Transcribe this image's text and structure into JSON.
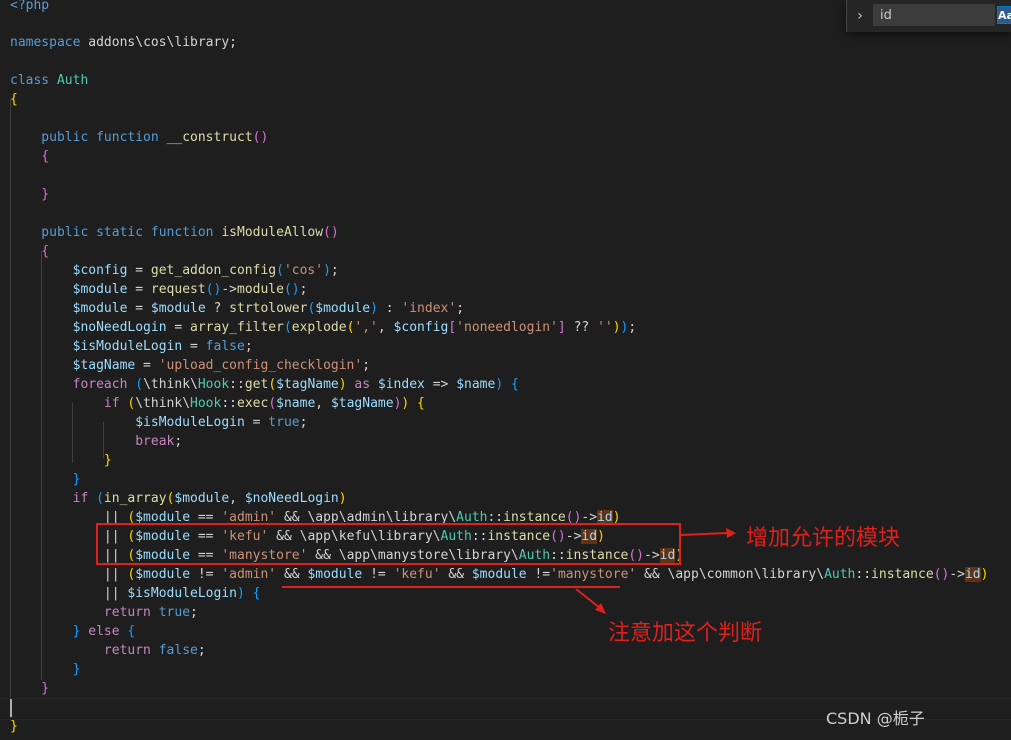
{
  "find_widget": {
    "query": "id",
    "match_case_label": "Aa"
  },
  "annotations": {
    "allowed_modules": "增加允许的模块",
    "note_condition": "注意加这个判断"
  },
  "watermark": "CSDN @栀子",
  "colors": {
    "annotation_red": "#e0201c",
    "editor_background": "#1e1e1e",
    "keyword": "#569cd6",
    "string": "#ce9178",
    "variable": "#9cdcfe",
    "function": "#dcdcaa",
    "class": "#4ec9b0",
    "match_highlight": "#613214"
  },
  "code": {
    "l0": [
      {
        "t": "<?php",
        "c": "kw"
      }
    ],
    "l1": [
      {
        "t": "namespace ",
        "c": "kw"
      },
      {
        "t": "addons\\cos\\library",
        "c": "plain"
      },
      {
        "t": ";",
        "c": "plain"
      }
    ],
    "l2": [
      {
        "t": "class ",
        "c": "kw"
      },
      {
        "t": "Auth",
        "c": "cls"
      }
    ],
    "l3": [
      {
        "t": "{",
        "c": "br1"
      }
    ],
    "l4": [
      {
        "t": "    public ",
        "c": "kw"
      },
      {
        "t": "function ",
        "c": "kw"
      },
      {
        "t": "__construct",
        "c": "fn"
      },
      {
        "t": "()",
        "c": "br2"
      }
    ],
    "l5": [
      {
        "t": "    {",
        "c": "br2"
      }
    ],
    "l6": [
      {
        "t": "    }",
        "c": "br2"
      }
    ],
    "l7": [
      {
        "t": "    public ",
        "c": "kw"
      },
      {
        "t": "static ",
        "c": "kw"
      },
      {
        "t": "function ",
        "c": "kw"
      },
      {
        "t": "isModuleAllow",
        "c": "fn"
      },
      {
        "t": "()",
        "c": "br2"
      }
    ],
    "l8": [
      {
        "t": "    {",
        "c": "br2"
      }
    ],
    "l9": [
      {
        "t": "        $config",
        "c": "var"
      },
      {
        "t": " = ",
        "c": "plain"
      },
      {
        "t": "get_addon_config",
        "c": "fn"
      },
      {
        "t": "(",
        "c": "br3"
      },
      {
        "t": "'cos'",
        "c": "str"
      },
      {
        "t": ")",
        "c": "br3"
      },
      {
        "t": ";",
        "c": "plain"
      }
    ],
    "l10": [
      {
        "t": "        $module",
        "c": "var"
      },
      {
        "t": " = ",
        "c": "plain"
      },
      {
        "t": "request",
        "c": "fn"
      },
      {
        "t": "()",
        "c": "br3"
      },
      {
        "t": "->",
        "c": "plain"
      },
      {
        "t": "module",
        "c": "fn"
      },
      {
        "t": "()",
        "c": "br3"
      },
      {
        "t": ";",
        "c": "plain"
      }
    ],
    "l11": [
      {
        "t": "        $module",
        "c": "var"
      },
      {
        "t": " = ",
        "c": "plain"
      },
      {
        "t": "$module",
        "c": "var"
      },
      {
        "t": " ? ",
        "c": "plain"
      },
      {
        "t": "strtolower",
        "c": "fn"
      },
      {
        "t": "(",
        "c": "br3"
      },
      {
        "t": "$module",
        "c": "var"
      },
      {
        "t": ")",
        "c": "br3"
      },
      {
        "t": " : ",
        "c": "plain"
      },
      {
        "t": "'index'",
        "c": "str"
      },
      {
        "t": ";",
        "c": "plain"
      }
    ],
    "l12": [
      {
        "t": "        $noNeedLogin",
        "c": "var"
      },
      {
        "t": " = ",
        "c": "plain"
      },
      {
        "t": "array_filter",
        "c": "fn"
      },
      {
        "t": "(",
        "c": "br3"
      },
      {
        "t": "explode",
        "c": "fn"
      },
      {
        "t": "(",
        "c": "br1"
      },
      {
        "t": "','",
        "c": "str"
      },
      {
        "t": ", ",
        "c": "plain"
      },
      {
        "t": "$config",
        "c": "var"
      },
      {
        "t": "[",
        "c": "br2"
      },
      {
        "t": "'noneedlogin'",
        "c": "str"
      },
      {
        "t": "]",
        "c": "br2"
      },
      {
        "t": " ?? ",
        "c": "plain"
      },
      {
        "t": "''",
        "c": "str"
      },
      {
        "t": ")",
        "c": "br1"
      },
      {
        "t": ")",
        "c": "br3"
      },
      {
        "t": ";",
        "c": "plain"
      }
    ],
    "l13": [
      {
        "t": "        $isModuleLogin",
        "c": "var"
      },
      {
        "t": " = ",
        "c": "plain"
      },
      {
        "t": "false",
        "c": "kw"
      },
      {
        "t": ";",
        "c": "plain"
      }
    ],
    "l14": [
      {
        "t": "        $tagName",
        "c": "var"
      },
      {
        "t": " = ",
        "c": "plain"
      },
      {
        "t": "'upload_config_checklogin'",
        "c": "str"
      },
      {
        "t": ";",
        "c": "plain"
      }
    ],
    "l15": [
      {
        "t": "        foreach ",
        "c": "ctl"
      },
      {
        "t": "(",
        "c": "br3"
      },
      {
        "t": "\\think\\",
        "c": "plain"
      },
      {
        "t": "Hook",
        "c": "cls"
      },
      {
        "t": "::",
        "c": "plain"
      },
      {
        "t": "get",
        "c": "fn"
      },
      {
        "t": "(",
        "c": "br1"
      },
      {
        "t": "$tagName",
        "c": "var"
      },
      {
        "t": ")",
        "c": "br1"
      },
      {
        "t": " as ",
        "c": "ctl"
      },
      {
        "t": "$index",
        "c": "var"
      },
      {
        "t": " => ",
        "c": "plain"
      },
      {
        "t": "$name",
        "c": "var"
      },
      {
        "t": ")",
        "c": "br3"
      },
      {
        "t": " {",
        "c": "br3"
      }
    ],
    "l16": [
      {
        "t": "            if ",
        "c": "ctl"
      },
      {
        "t": "(",
        "c": "br1"
      },
      {
        "t": "\\think\\",
        "c": "plain"
      },
      {
        "t": "Hook",
        "c": "cls"
      },
      {
        "t": "::",
        "c": "plain"
      },
      {
        "t": "exec",
        "c": "fn"
      },
      {
        "t": "(",
        "c": "br2"
      },
      {
        "t": "$name",
        "c": "var"
      },
      {
        "t": ", ",
        "c": "plain"
      },
      {
        "t": "$tagName",
        "c": "var"
      },
      {
        "t": ")",
        "c": "br2"
      },
      {
        "t": ")",
        "c": "br1"
      },
      {
        "t": " {",
        "c": "br1"
      }
    ],
    "l17": [
      {
        "t": "                $isModuleLogin",
        "c": "var"
      },
      {
        "t": " = ",
        "c": "plain"
      },
      {
        "t": "true",
        "c": "kw"
      },
      {
        "t": ";",
        "c": "plain"
      }
    ],
    "l18": [
      {
        "t": "                break",
        "c": "ctl"
      },
      {
        "t": ";",
        "c": "plain"
      }
    ],
    "l19": [
      {
        "t": "            }",
        "c": "br1"
      }
    ],
    "l20": [
      {
        "t": "        }",
        "c": "br3"
      }
    ],
    "l21": [
      {
        "t": "        if ",
        "c": "ctl"
      },
      {
        "t": "(",
        "c": "br3"
      },
      {
        "t": "in_array",
        "c": "fn"
      },
      {
        "t": "(",
        "c": "br1"
      },
      {
        "t": "$module",
        "c": "var"
      },
      {
        "t": ", ",
        "c": "plain"
      },
      {
        "t": "$noNeedLogin",
        "c": "var"
      },
      {
        "t": ")",
        "c": "br1"
      }
    ],
    "l22": [
      {
        "t": "            || ",
        "c": "plain"
      },
      {
        "t": "(",
        "c": "br1"
      },
      {
        "t": "$module",
        "c": "var"
      },
      {
        "t": " == ",
        "c": "plain"
      },
      {
        "t": "'admin'",
        "c": "str"
      },
      {
        "t": " && ",
        "c": "plain"
      },
      {
        "t": "\\app\\admin\\library\\",
        "c": "plain"
      },
      {
        "t": "Auth",
        "c": "cls"
      },
      {
        "t": "::",
        "c": "plain"
      },
      {
        "t": "instance",
        "c": "fn"
      },
      {
        "t": "()",
        "c": "br2"
      },
      {
        "t": "->",
        "c": "plain"
      },
      {
        "t": "id",
        "c": "var",
        "h": true
      },
      {
        "t": ")",
        "c": "br1"
      }
    ],
    "l23": [
      {
        "t": "            || ",
        "c": "plain"
      },
      {
        "t": "(",
        "c": "br1"
      },
      {
        "t": "$module",
        "c": "var"
      },
      {
        "t": " == ",
        "c": "plain"
      },
      {
        "t": "'kefu'",
        "c": "str"
      },
      {
        "t": " && ",
        "c": "plain"
      },
      {
        "t": "\\app\\kefu\\library\\",
        "c": "plain"
      },
      {
        "t": "Auth",
        "c": "cls"
      },
      {
        "t": "::",
        "c": "plain"
      },
      {
        "t": "instance",
        "c": "fn"
      },
      {
        "t": "()",
        "c": "br2"
      },
      {
        "t": "->",
        "c": "plain"
      },
      {
        "t": "id",
        "c": "var",
        "h": true
      },
      {
        "t": ")",
        "c": "br1"
      }
    ],
    "l24": [
      {
        "t": "            || ",
        "c": "plain"
      },
      {
        "t": "(",
        "c": "br1"
      },
      {
        "t": "$module",
        "c": "var"
      },
      {
        "t": " == ",
        "c": "plain"
      },
      {
        "t": "'manystore'",
        "c": "str"
      },
      {
        "t": " && ",
        "c": "plain"
      },
      {
        "t": "\\app\\manystore\\library\\",
        "c": "plain"
      },
      {
        "t": "Auth",
        "c": "cls"
      },
      {
        "t": "::",
        "c": "plain"
      },
      {
        "t": "instance",
        "c": "fn"
      },
      {
        "t": "()",
        "c": "br2"
      },
      {
        "t": "->",
        "c": "plain"
      },
      {
        "t": "id",
        "c": "var",
        "h": true
      },
      {
        "t": ")",
        "c": "br1"
      }
    ],
    "l25": [
      {
        "t": "            || ",
        "c": "plain"
      },
      {
        "t": "(",
        "c": "br1"
      },
      {
        "t": "$module",
        "c": "var"
      },
      {
        "t": " != ",
        "c": "plain"
      },
      {
        "t": "'admin'",
        "c": "str"
      },
      {
        "t": " && ",
        "c": "plain"
      },
      {
        "t": "$module",
        "c": "var"
      },
      {
        "t": " != ",
        "c": "plain"
      },
      {
        "t": "'kefu'",
        "c": "str"
      },
      {
        "t": " && ",
        "c": "plain"
      },
      {
        "t": "$module",
        "c": "var"
      },
      {
        "t": " !=",
        "c": "plain"
      },
      {
        "t": "'manystore'",
        "c": "str"
      },
      {
        "t": " && ",
        "c": "plain"
      },
      {
        "t": "\\app\\common\\library\\",
        "c": "plain"
      },
      {
        "t": "Auth",
        "c": "cls"
      },
      {
        "t": "::",
        "c": "plain"
      },
      {
        "t": "instance",
        "c": "fn"
      },
      {
        "t": "()",
        "c": "br2"
      },
      {
        "t": "->",
        "c": "plain"
      },
      {
        "t": "id",
        "c": "var",
        "h": true
      },
      {
        "t": ")",
        "c": "br1"
      }
    ],
    "l26": [
      {
        "t": "            || ",
        "c": "plain"
      },
      {
        "t": "$isModuleLogin",
        "c": "var"
      },
      {
        "t": ")",
        "c": "br3"
      },
      {
        "t": " {",
        "c": "br3"
      }
    ],
    "l27": [
      {
        "t": "            return ",
        "c": "ctl"
      },
      {
        "t": "true",
        "c": "kw"
      },
      {
        "t": ";",
        "c": "plain"
      }
    ],
    "l28": [
      {
        "t": "        }",
        "c": "br3"
      },
      {
        "t": " else ",
        "c": "ctl"
      },
      {
        "t": "{",
        "c": "br3"
      }
    ],
    "l29": [
      {
        "t": "            return ",
        "c": "ctl"
      },
      {
        "t": "false",
        "c": "kw"
      },
      {
        "t": ";",
        "c": "plain"
      }
    ],
    "l30": [
      {
        "t": "        }",
        "c": "br3"
      }
    ],
    "l31": [
      {
        "t": "    }",
        "c": "br2"
      }
    ],
    "l32": [
      {
        "t": "}",
        "c": "br1"
      }
    ]
  }
}
